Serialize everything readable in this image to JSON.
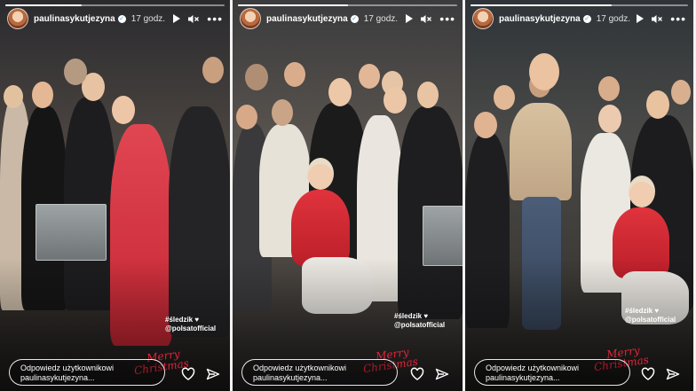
{
  "stories": [
    {
      "username": "paulinasykutjezyna",
      "time": "17 godz.",
      "progress": 0.35,
      "reply_line1": "Odpowiedz użytkownikowi",
      "reply_line2": "paulinasykutjezyna...",
      "tag1": "#śledzik ♥",
      "tag2": "@polsatofficial",
      "xmas1": "Merry",
      "xmas2": "Christmas"
    },
    {
      "username": "paulinasykutjezyna",
      "time": "17 godz.",
      "progress": 0.5,
      "reply_line1": "Odpowiedz użytkownikowi",
      "reply_line2": "paulinasykutjezyna...",
      "tag1": "#śledzik ♥",
      "tag2": "@polsatofficial",
      "xmas1": "Merry",
      "xmas2": "Christmas"
    },
    {
      "username": "paulinasykutjezyna",
      "time": "17 godz.",
      "progress": 0.65,
      "reply_line1": "Odpowiedz użytkownikowi",
      "reply_line2": "paulinasykutjezyna...",
      "tag1": "#śledzik ♥",
      "tag2": "@polsatofficial",
      "xmas1": "Merry",
      "xmas2": "Christmas"
    }
  ],
  "icons": {
    "play": "play-icon",
    "mute": "mute-icon",
    "more": "more-icon",
    "verified": "verified-badge-icon",
    "like": "heart-icon",
    "share": "send-icon"
  },
  "colors": {
    "red_outfit": "#d62a33",
    "xmas_text": "#e0263a",
    "verified_blue": "#3897f0"
  }
}
